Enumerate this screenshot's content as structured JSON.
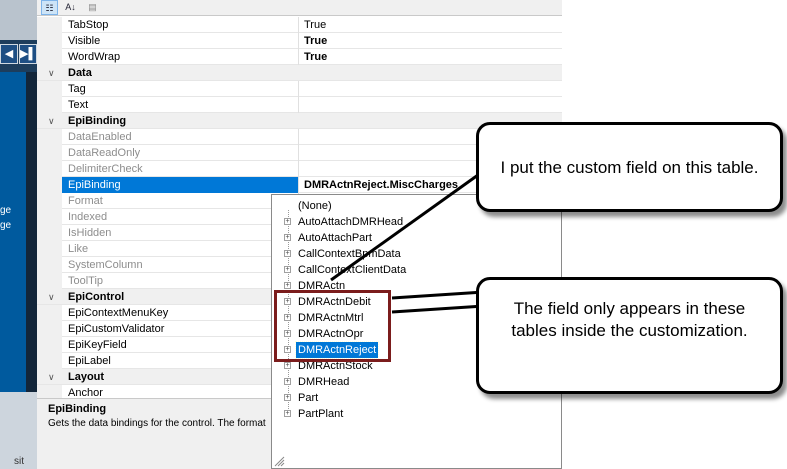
{
  "left": {
    "fragments": [
      "ge",
      "ge"
    ],
    "bottom_fragment": "sit",
    "nav_prev": "◀",
    "nav_next": "▶▌"
  },
  "toolbar": {
    "categorized_icon": "categorized-icon",
    "alphabetical_icon": "sort-az-icon",
    "alphabetical_glyph": "A↓",
    "pages_icon": "property-pages-icon",
    "categorized_glyph": "☷",
    "pages_glyph": "▤"
  },
  "grid": {
    "rows": [
      {
        "type": "prop",
        "name": "TabStop",
        "value": "True"
      },
      {
        "type": "prop",
        "name": "Visible",
        "value": "True",
        "bold": true
      },
      {
        "type": "prop",
        "name": "WordWrap",
        "value": "True",
        "bold": true
      },
      {
        "type": "cat",
        "name": "Data",
        "toggle": "∨"
      },
      {
        "type": "prop",
        "name": "Tag",
        "value": ""
      },
      {
        "type": "prop",
        "name": "Text",
        "value": ""
      },
      {
        "type": "cat",
        "name": "EpiBinding",
        "toggle": "∨"
      },
      {
        "type": "prop",
        "name": "DataEnabled",
        "value": "",
        "disabled": true
      },
      {
        "type": "prop",
        "name": "DataReadOnly",
        "value": "",
        "disabled": true
      },
      {
        "type": "prop",
        "name": "DelimiterCheck",
        "value": "",
        "disabled": true
      },
      {
        "type": "prop",
        "name": "EpiBinding",
        "value": "DMRActnReject.MiscCharges",
        "selected": true,
        "bold": true
      },
      {
        "type": "prop",
        "name": "Format",
        "value": "",
        "disabled": true
      },
      {
        "type": "prop",
        "name": "Indexed",
        "value": "",
        "disabled": true
      },
      {
        "type": "prop",
        "name": "IsHidden",
        "value": "",
        "disabled": true
      },
      {
        "type": "prop",
        "name": "Like",
        "value": "",
        "disabled": true
      },
      {
        "type": "prop",
        "name": "SystemColumn",
        "value": "",
        "disabled": true
      },
      {
        "type": "prop",
        "name": "ToolTip",
        "value": "",
        "disabled": true
      },
      {
        "type": "cat",
        "name": "EpiControl",
        "toggle": "∨"
      },
      {
        "type": "prop",
        "name": "EpiContextMenuKey",
        "value": ""
      },
      {
        "type": "prop",
        "name": "EpiCustomValidator",
        "value": ""
      },
      {
        "type": "prop",
        "name": "EpiKeyField",
        "value": ""
      },
      {
        "type": "prop",
        "name": "EpiLabel",
        "value": ""
      },
      {
        "type": "cat",
        "name": "Layout",
        "toggle": "∨"
      },
      {
        "type": "prop",
        "name": "Anchor",
        "value": ""
      }
    ]
  },
  "description": {
    "title": "EpiBinding",
    "text": "Gets the data bindings for the control. The format"
  },
  "dropdown": {
    "items": [
      {
        "label": "(None)",
        "expander": false
      },
      {
        "label": "AutoAttachDMRHead",
        "expander": true
      },
      {
        "label": "AutoAttachPart",
        "expander": true
      },
      {
        "label": "CallContextBpmData",
        "expander": true
      },
      {
        "label": "CallContextClientData",
        "expander": true
      },
      {
        "label": "DMRActn",
        "expander": true
      },
      {
        "label": "DMRActnDebit",
        "expander": true
      },
      {
        "label": "DMRActnMtrl",
        "expander": true
      },
      {
        "label": "DMRActnOpr",
        "expander": true
      },
      {
        "label": "DMRActnReject",
        "expander": true,
        "selected": true
      },
      {
        "label": "DMRActnStock",
        "expander": true
      },
      {
        "label": "DMRHead",
        "expander": true
      },
      {
        "label": "Part",
        "expander": true
      },
      {
        "label": "PartPlant",
        "expander": true
      }
    ],
    "expander_glyph": "+"
  },
  "callouts": {
    "top": "I put the custom field on this table.",
    "bottom": "The field only appears in these tables inside the customization."
  },
  "colors": {
    "selection": "#0078d7",
    "highlight_box": "#7b1c1c",
    "left_panel": "#005a9e"
  }
}
